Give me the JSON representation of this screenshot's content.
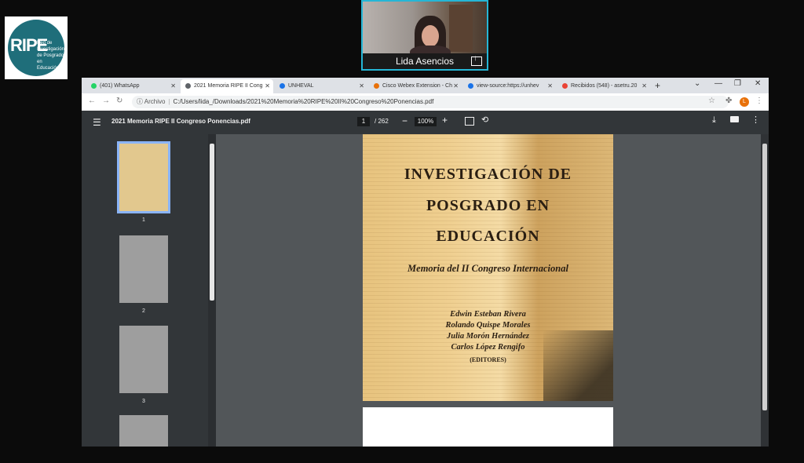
{
  "logo": {
    "text": "RIPE",
    "subtitle": "Red de Investigación de Posgrado en Educación"
  },
  "video": {
    "participant_name": "Lida Asencios"
  },
  "browser": {
    "tabs": [
      {
        "label": "(401) WhatsApp",
        "color": "#25d366"
      },
      {
        "label": "2021 Memoria RIPE II Cong",
        "color": "#5f6368"
      },
      {
        "label": "UNHEVAL",
        "color": "#1a73e8"
      },
      {
        "label": "Cisco Webex Extension - Ch",
        "color": "#e8710a"
      },
      {
        "label": "view-source:https://unhev",
        "color": "#1a73e8"
      },
      {
        "label": "Recibidos (548) - asetru.20",
        "color": "#ea4335"
      }
    ],
    "url_label": "Archivo",
    "url": "C:/Users/lida_/Downloads/2021%20Memoria%20RIPE%20II%20Congreso%20Ponencias.pdf",
    "profile_initial": "L"
  },
  "pdf": {
    "title": "2021 Memoria RIPE II Congreso Ponencias.pdf",
    "page_current": "1",
    "page_total": "/ 262",
    "zoom": "100%",
    "thumb_numbers": [
      "1",
      "2",
      "3"
    ]
  },
  "cover": {
    "title_lines": [
      "INVESTIGACIÓN DE",
      "POSGRADO EN",
      "EDUCACIÓN"
    ],
    "subtitle": "Memoria del II Congreso Internacional",
    "editors": [
      "Edwin Esteban Rivera",
      "Rolando Quispe Morales",
      "Julia Morón Hernández",
      "Carlos López Rengifo"
    ],
    "editors_label": "(EDITORES)"
  }
}
